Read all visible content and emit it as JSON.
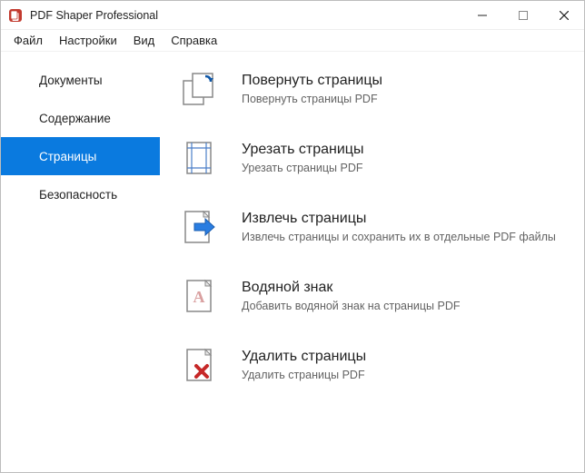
{
  "app": {
    "title": "PDF Shaper Professional"
  },
  "menubar": {
    "file": "Файл",
    "settings": "Настройки",
    "view": "Вид",
    "help": "Справка"
  },
  "sidebar": {
    "items": [
      {
        "label": "Документы"
      },
      {
        "label": "Содержание"
      },
      {
        "label": "Страницы"
      },
      {
        "label": "Безопасность"
      }
    ]
  },
  "actions": [
    {
      "title": "Повернуть страницы",
      "desc": "Повернуть страницы PDF"
    },
    {
      "title": "Урезать страницы",
      "desc": "Урезать страницы PDF"
    },
    {
      "title": "Извлечь страницы",
      "desc": "Извлечь страницы и сохранить их в отдельные PDF файлы"
    },
    {
      "title": "Водяной знак",
      "desc": "Добавить водяной знак на страницы PDF"
    },
    {
      "title": "Удалить страницы",
      "desc": "Удалить страницы PDF"
    }
  ]
}
